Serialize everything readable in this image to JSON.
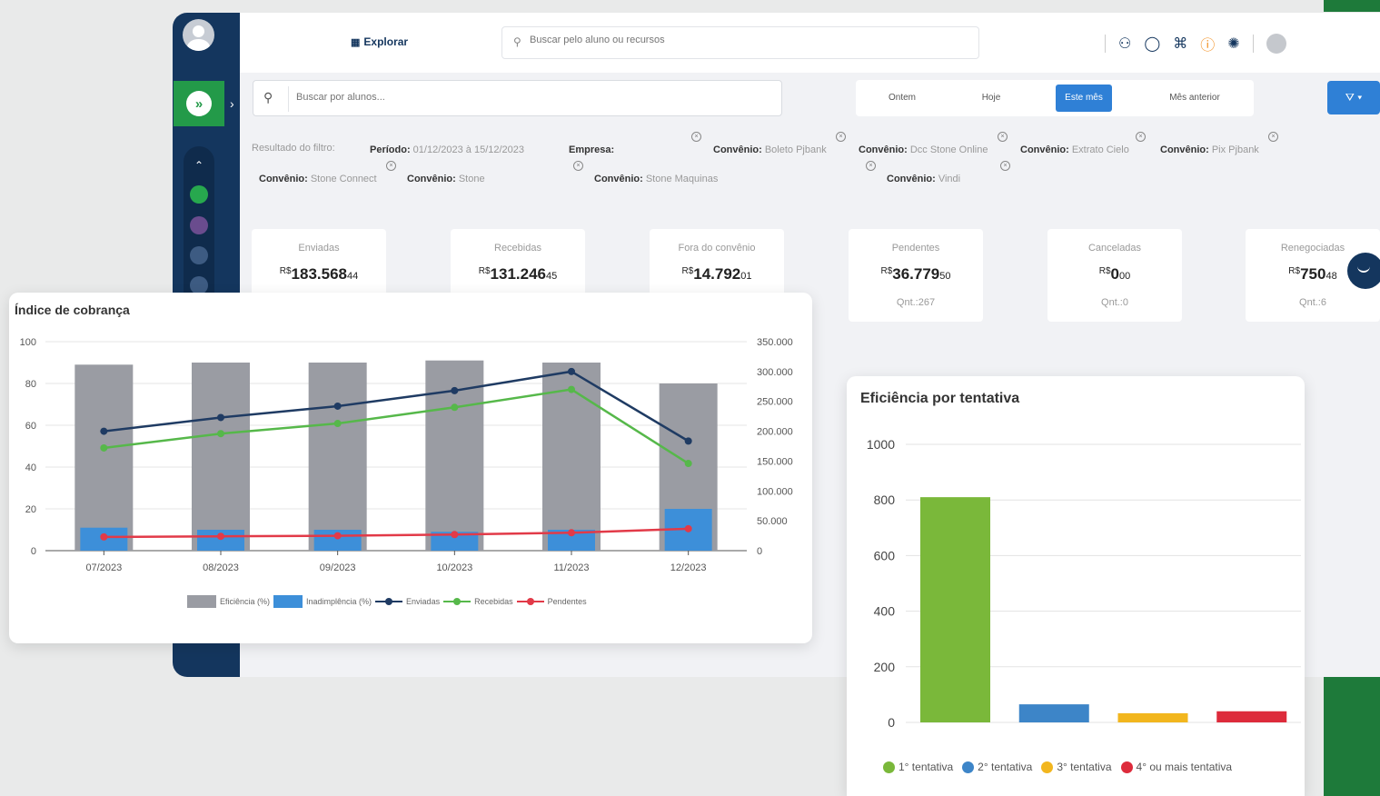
{
  "topbar": {
    "explore_label": "Explorar",
    "search_placeholder": "Buscar pelo aluno ou recursos"
  },
  "content": {
    "search_placeholder": "Buscar por alunos...",
    "period_tabs": [
      "Ontem",
      "Hoje",
      "Este mês",
      "Mês anterior"
    ],
    "active_period": "Este mês"
  },
  "filters": {
    "label": "Resultado do filtro:",
    "chips": [
      {
        "key": "Período:",
        "value": " 01/12/2023 à 15/12/2023"
      },
      {
        "key": "Empresa:",
        "value": ""
      },
      {
        "key": "Convênio:",
        "value": " Boleto Pjbank"
      },
      {
        "key": "Convênio:",
        "value": " Dcc Stone Online"
      },
      {
        "key": "Convênio:",
        "value": " Extrato Cielo"
      },
      {
        "key": "Convênio:",
        "value": " Pix Pjbank"
      },
      {
        "key": "Convênio:",
        "value": " Stone Connect"
      },
      {
        "key": "Convênio:",
        "value": " Stone"
      },
      {
        "key": "Convênio:",
        "value": " Stone Maquinas"
      },
      {
        "key": "Convênio:",
        "value": " Vindi"
      }
    ]
  },
  "kpis": [
    {
      "label": "Enviadas",
      "currency": "R$",
      "int": "183.568",
      "dec": "44",
      "qnt": ""
    },
    {
      "label": "Recebidas",
      "currency": "R$",
      "int": "131.246",
      "dec": "45",
      "qnt": ""
    },
    {
      "label": "Fora do convênio",
      "currency": "R$",
      "int": "14.792",
      "dec": "01",
      "qnt": ""
    },
    {
      "label": "Pendentes",
      "currency": "R$",
      "int": "36.779",
      "dec": "50",
      "qnt": "Qnt.:267"
    },
    {
      "label": "Canceladas",
      "currency": "R$",
      "int": "0",
      "dec": "00",
      "qnt": "Qnt.:0"
    },
    {
      "label": "Renegociadas",
      "currency": "R$",
      "int": "750",
      "dec": "48",
      "qnt": "Qnt.:6"
    }
  ],
  "colors": {
    "navy": "#14365e",
    "green": "#239a49",
    "blue": "#2f80d6",
    "gray_bar": "#9a9ca3",
    "blue_bar": "#3d8fd9",
    "line_enviadas": "#1f3b63",
    "line_recebidas": "#56b84a",
    "line_pendentes": "#e23a48"
  },
  "chart_data": [
    {
      "type": "bar",
      "title": "Índice de cobrança",
      "categories": [
        "07/2023",
        "08/2023",
        "09/2023",
        "10/2023",
        "11/2023",
        "12/2023"
      ],
      "y_left": {
        "ticks": [
          "100",
          "80",
          "60",
          "40",
          "20",
          "0"
        ],
        "range": [
          0,
          100
        ]
      },
      "y_right": {
        "ticks": [
          "350.000",
          "300.000",
          "250.000",
          "200.000",
          "150.000",
          "100.000",
          "50.000",
          "0"
        ],
        "range": [
          0,
          350000
        ]
      },
      "series": [
        {
          "name": "Eficiência (%)",
          "kind": "bar",
          "axis": "left",
          "values": [
            89,
            90,
            90,
            91,
            90,
            80
          ]
        },
        {
          "name": "Inadimplência (%)",
          "kind": "bar",
          "axis": "left",
          "values": [
            11,
            10,
            10,
            9,
            10,
            20
          ]
        },
        {
          "name": "Enviadas",
          "kind": "line",
          "axis": "right",
          "values": [
            200000,
            223000,
            242000,
            268000,
            300000,
            183568
          ]
        },
        {
          "name": "Recebidas",
          "kind": "line",
          "axis": "right",
          "values": [
            172000,
            196000,
            213000,
            240000,
            270000,
            146000
          ]
        },
        {
          "name": "Pendentes",
          "kind": "line",
          "axis": "right",
          "values": [
            23000,
            24000,
            25000,
            27000,
            30000,
            36780
          ]
        }
      ],
      "legend": "bottom",
      "grid": true
    },
    {
      "type": "bar",
      "title": "Eficiência por tentativa",
      "categories": [
        "1° tentativa",
        "2° tentativa",
        "3° tentativa",
        "4° ou mais tentativa"
      ],
      "values": [
        810,
        65,
        33,
        40
      ],
      "colors": [
        "#7ab83a",
        "#3d85c8",
        "#f2b61e",
        "#dd2b3b"
      ],
      "y_ticks": [
        "1000",
        "800",
        "600",
        "400",
        "200",
        "0"
      ],
      "ylim": [
        0,
        1000
      ],
      "legend": "bottom",
      "grid": true
    }
  ]
}
